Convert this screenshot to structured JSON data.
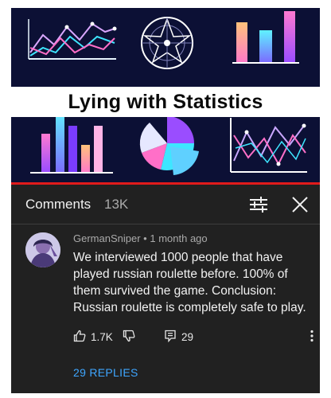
{
  "thumbnail": {
    "title": "Lying with Statistics",
    "colors": {
      "background": "#0c1035",
      "pink": "#ff6fc8",
      "cyan": "#3ee6ff",
      "purple": "#8a4dff",
      "orange": "#ffb074",
      "lavender": "#c9a7ff",
      "red": "#e01b1b"
    }
  },
  "comments": {
    "label": "Comments",
    "count": "13K"
  },
  "comment": {
    "username": "GermanSniper",
    "separator": "•",
    "timestamp": "1 month ago",
    "text": "We interviewed 1000 people that have played russian roulette before. 100% of them survived the game. Conclusion: Russian roulette is completely safe to play.",
    "likes": "1.7K",
    "reply_count": "29",
    "replies_link": "29 REPLIES"
  },
  "icons": {
    "filter": "sliders-icon",
    "close": "close-icon",
    "like": "thumbs-up-icon",
    "dislike": "thumbs-down-icon",
    "reply": "comment-icon",
    "more": "more-vert-icon"
  },
  "theme": {
    "surface": "#212121",
    "text_primary": "#f1f1f1",
    "text_secondary": "#aaaaaa",
    "link": "#3ea6ff"
  }
}
